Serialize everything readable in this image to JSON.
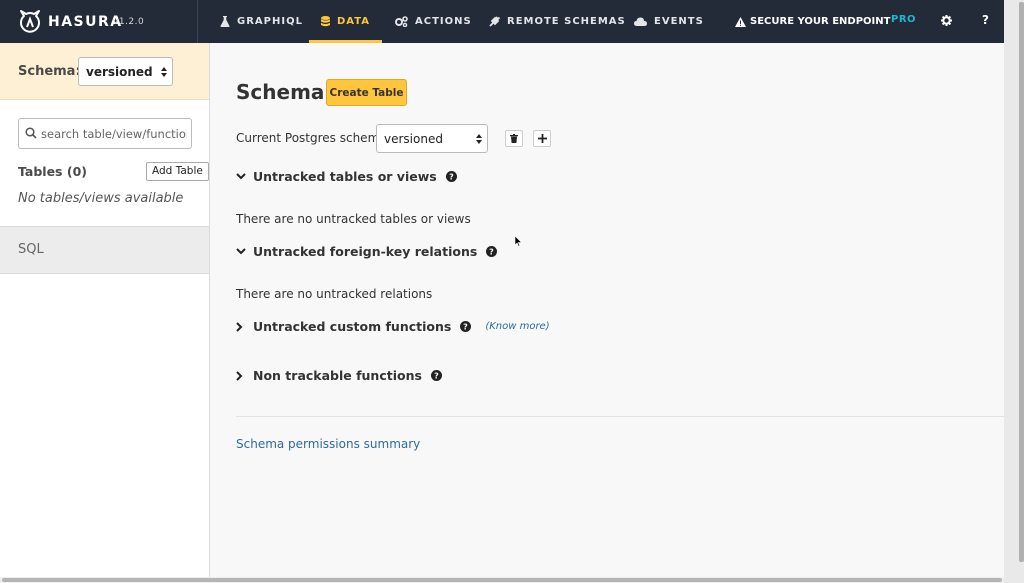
{
  "brand": {
    "name": "HASURA",
    "version": "v1.2.0"
  },
  "nav": {
    "items": [
      {
        "label": "GRAPHIQL",
        "icon": "flask-icon"
      },
      {
        "label": "DATA",
        "icon": "database-icon",
        "active": true
      },
      {
        "label": "ACTIONS",
        "icon": "cogs-icon"
      },
      {
        "label": "REMOTE SCHEMAS",
        "icon": "plug-icon"
      },
      {
        "label": "EVENTS",
        "icon": "cloud-icon"
      }
    ],
    "secure": "SECURE YOUR ENDPOINT",
    "pro": "PRO",
    "help": "?"
  },
  "sidebar": {
    "schema_label": "Schema:",
    "schema_value": "versioned",
    "search_placeholder": "search table/view/function",
    "tables_title": "Tables (0)",
    "add_table": "Add Table",
    "empty": "No tables/views available",
    "sql": "SQL"
  },
  "main": {
    "title": "Schema",
    "create_table": "Create Table",
    "current_schema_label": "Current Postgres schema",
    "current_schema_value": "versioned",
    "sections": {
      "untracked_tables": "Untracked tables or views",
      "untracked_tables_msg": "There are no untracked tables or views",
      "untracked_fk": "Untracked foreign-key relations",
      "untracked_fk_msg": "There are no untracked relations",
      "untracked_functions": "Untracked custom functions",
      "know_more": "(Know more)",
      "non_trackable": "Non trackable functions"
    },
    "permissions_link": "Schema permissions summary"
  },
  "colors": {
    "topbar": "#222b37",
    "accent": "#fec53d",
    "pro": "#1eb4d4",
    "link": "#2e6b9e"
  }
}
